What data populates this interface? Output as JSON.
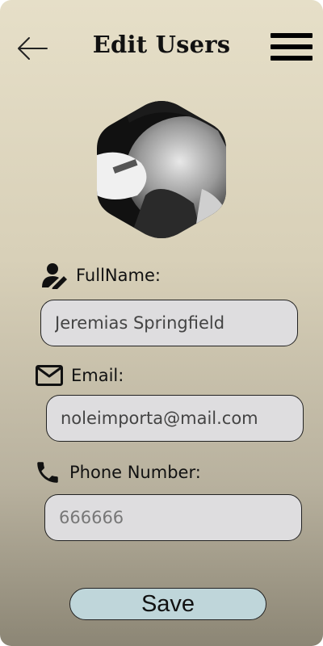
{
  "header": {
    "title": "Edit Users",
    "back_icon": "arrow-left-icon",
    "menu_icon": "hamburger-menu-icon"
  },
  "profile": {
    "avatar_icon": "hexagon-avatar"
  },
  "form": {
    "fullname": {
      "label": "FullName:",
      "icon": "user-edit-icon",
      "value": "Jeremias Springfield"
    },
    "email": {
      "label": "Email:",
      "icon": "mail-icon",
      "value": "noleimporta@mail.com"
    },
    "phone": {
      "label": "Phone Number:",
      "icon": "phone-icon",
      "value": "",
      "placeholder": "666666"
    }
  },
  "actions": {
    "save_label": "Save"
  },
  "colors": {
    "save_button": "#bfd6da",
    "input_bg": "#dedddf",
    "bg_top": "#e6dfc8",
    "bg_bottom": "#8c8675"
  }
}
